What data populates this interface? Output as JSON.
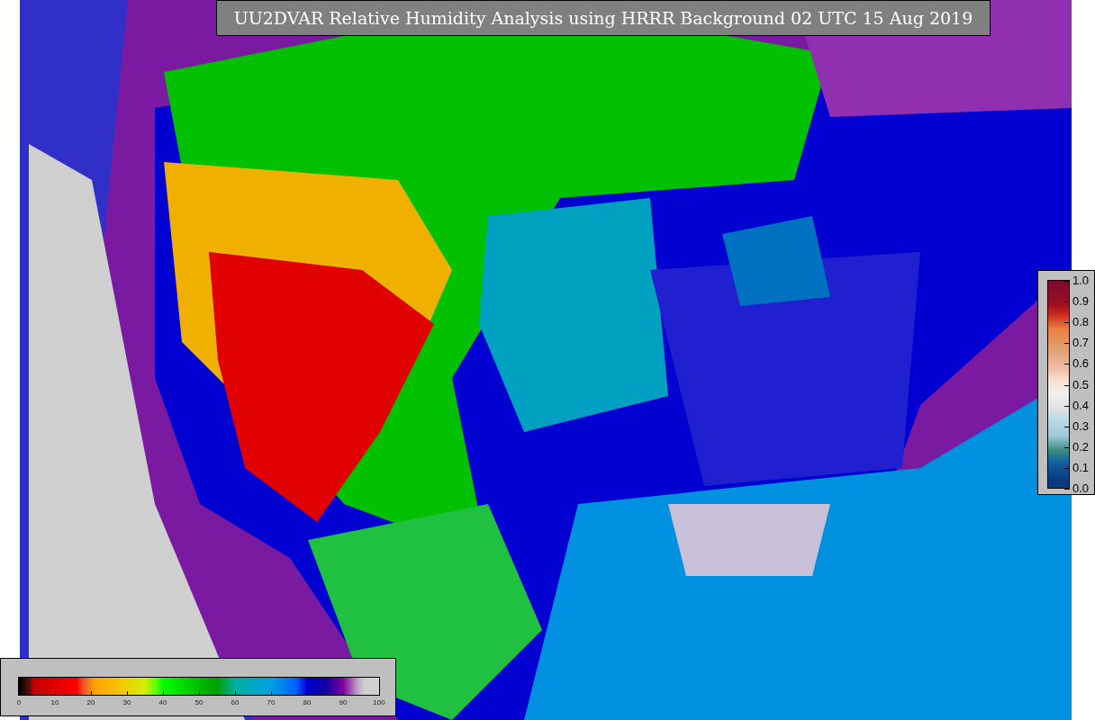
{
  "title": "UU2DVAR Relative Humidity Analysis using HRRR Background 02 UTC 15 Aug 2019",
  "humidity_colorbar": {
    "ticks": [
      "0",
      "10",
      "20",
      "30",
      "40",
      "50",
      "60",
      "70",
      "80",
      "90",
      "100"
    ]
  },
  "ratio_colorbar": {
    "ticks": [
      "1.0",
      "0.9",
      "0.8",
      "0.7",
      "0.6",
      "0.5",
      "0.4",
      "0.3",
      "0.2",
      "0.1",
      "0.0"
    ]
  }
}
